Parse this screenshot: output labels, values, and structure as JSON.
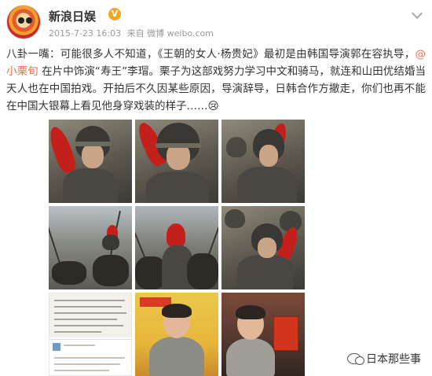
{
  "post": {
    "author": "新浪日娱",
    "verified_badge": "V",
    "date": "2015-7-23 16:03",
    "source": "来自 微博 weibo.com",
    "text_before_mention": "八卦一嘴：可能很多人不知道，《王朝的女人·杨贵妃》最初是由韩国导演郭在容执导，",
    "mention": "@小栗旬",
    "text_after_mention": " 在片中饰演“寿王”李瑁。栗子为这部戏努力学习中文和骑马，就连和山田优结婚当天人也在中国拍戏。开拍后不久因某些原因，导演辞导，日韩合作方撤走，你们也再不能在中国大银幕上看见他身穿戏装的样子……",
    "emoji": "😢"
  },
  "watermark": {
    "text": "日本那些事"
  },
  "icons": {
    "avatar": "avatar-image",
    "menu": "chevron-down-icon",
    "watermark": "wechat-icon"
  },
  "colors": {
    "mention": "#eb7350",
    "meta": "#999999",
    "badge": "#f5a623"
  }
}
